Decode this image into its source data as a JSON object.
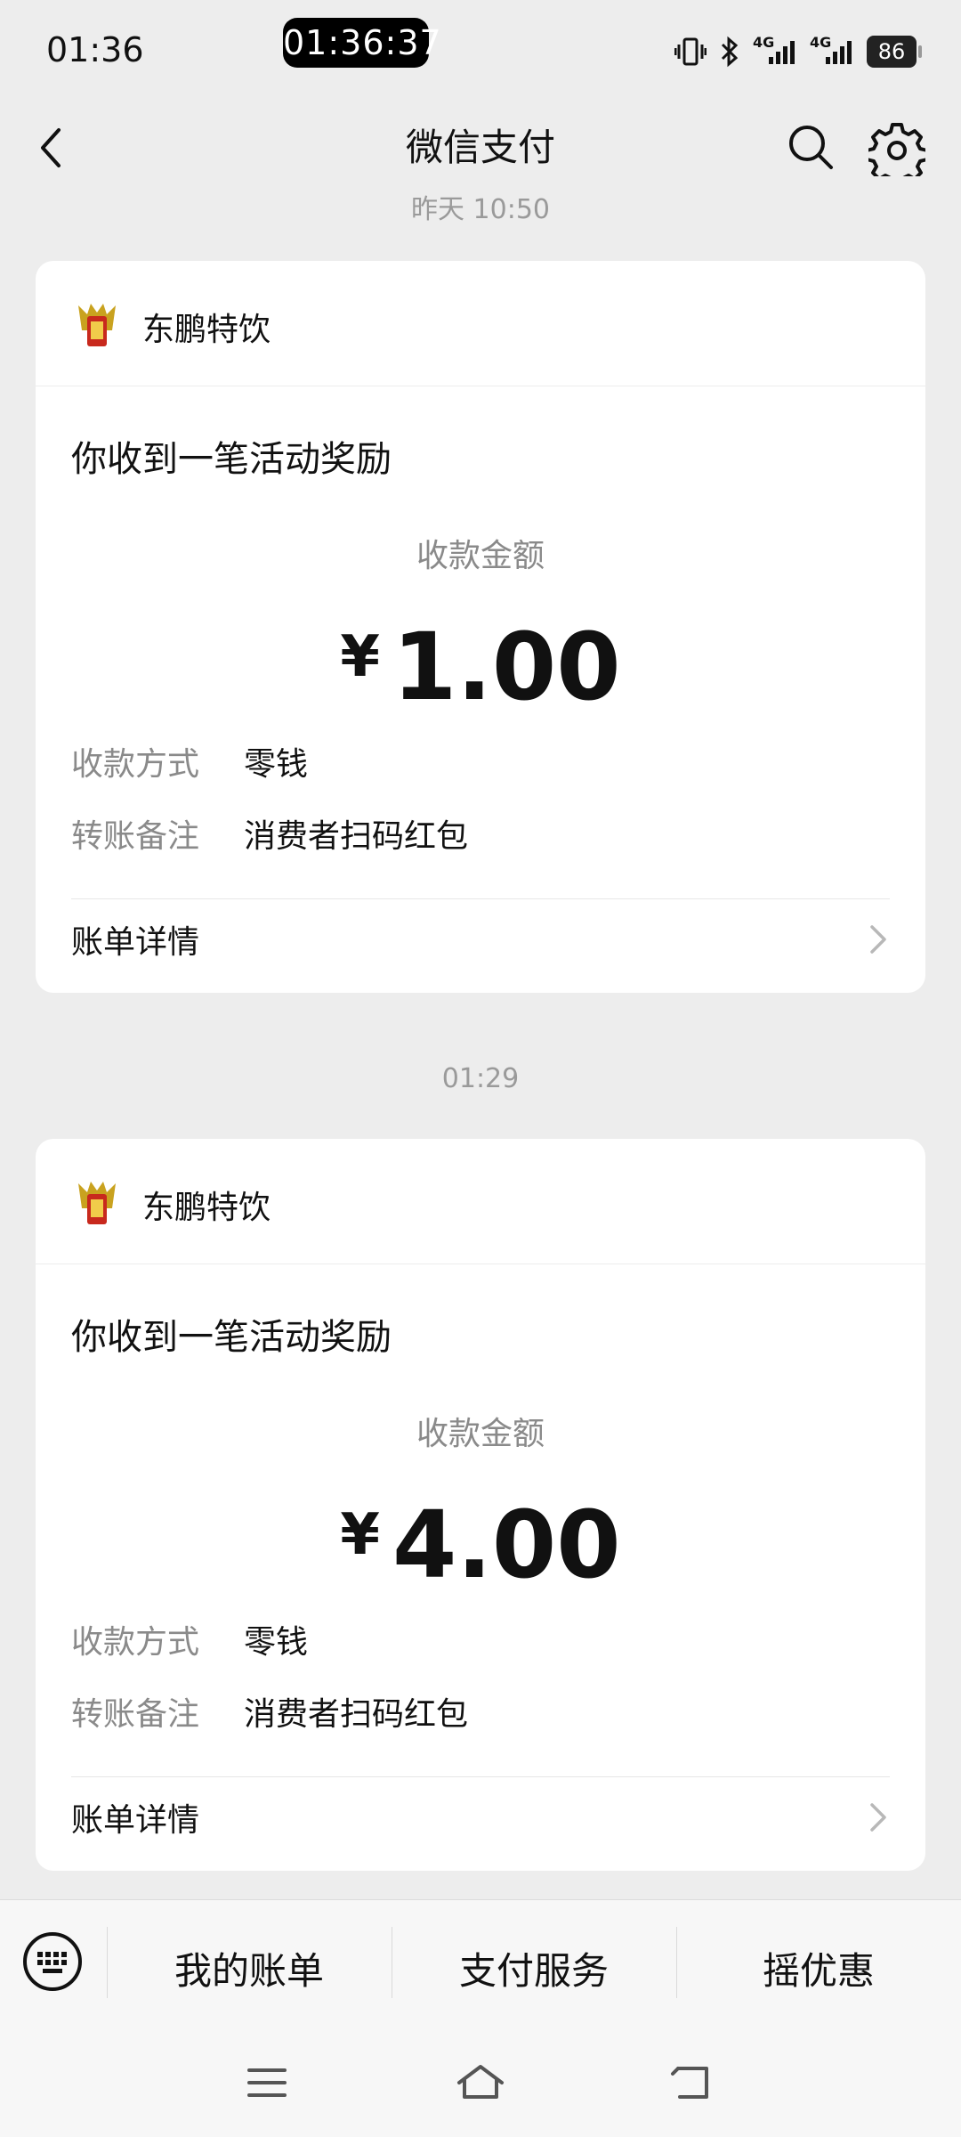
{
  "status_bar": {
    "time": "01:36",
    "clock_pill": "01:36:37",
    "network_1": "4G",
    "network_2": "4G",
    "battery": "86"
  },
  "nav": {
    "title": "微信支付",
    "icons": [
      "back-arrow-icon",
      "search-icon",
      "gear-icon"
    ]
  },
  "feed": {
    "partial_time": "昨天 10:50",
    "messages": [
      {
        "merchant": "东鹏特饮",
        "title": "你收到一笔活动奖励",
        "amount_label": "收款金额",
        "currency": "¥",
        "amount": "1.00",
        "method_label": "收款方式",
        "method_value": "零钱",
        "note_label": "转账备注",
        "note_value": "消费者扫码红包",
        "detail_label": "账单详情"
      },
      {
        "time": "01:29",
        "merchant": "东鹏特饮",
        "title": "你收到一笔活动奖励",
        "amount_label": "收款金额",
        "currency": "¥",
        "amount": "4.00",
        "method_label": "收款方式",
        "method_value": "零钱",
        "note_label": "转账备注",
        "note_value": "消费者扫码红包",
        "detail_label": "账单详情"
      }
    ]
  },
  "bottom_menu": {
    "items": [
      "我的账单",
      "支付服务",
      "摇优惠"
    ]
  },
  "colors": {
    "background": "#ededed",
    "card": "#ffffff",
    "muted_text": "#8a8a8a"
  }
}
